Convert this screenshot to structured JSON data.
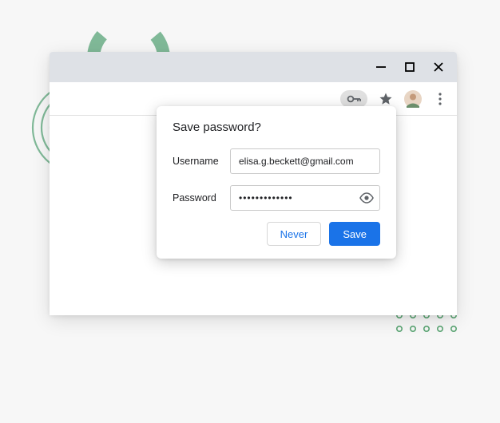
{
  "popover": {
    "title": "Save password?",
    "username_label": "Username",
    "username_value": "elisa.g.beckett@gmail.com",
    "password_label": "Password",
    "password_value": "•••••••••••••",
    "never_label": "Never",
    "save_label": "Save"
  },
  "colors": {
    "accent_primary": "#1a73e8",
    "decorative_green": "#80b998"
  }
}
